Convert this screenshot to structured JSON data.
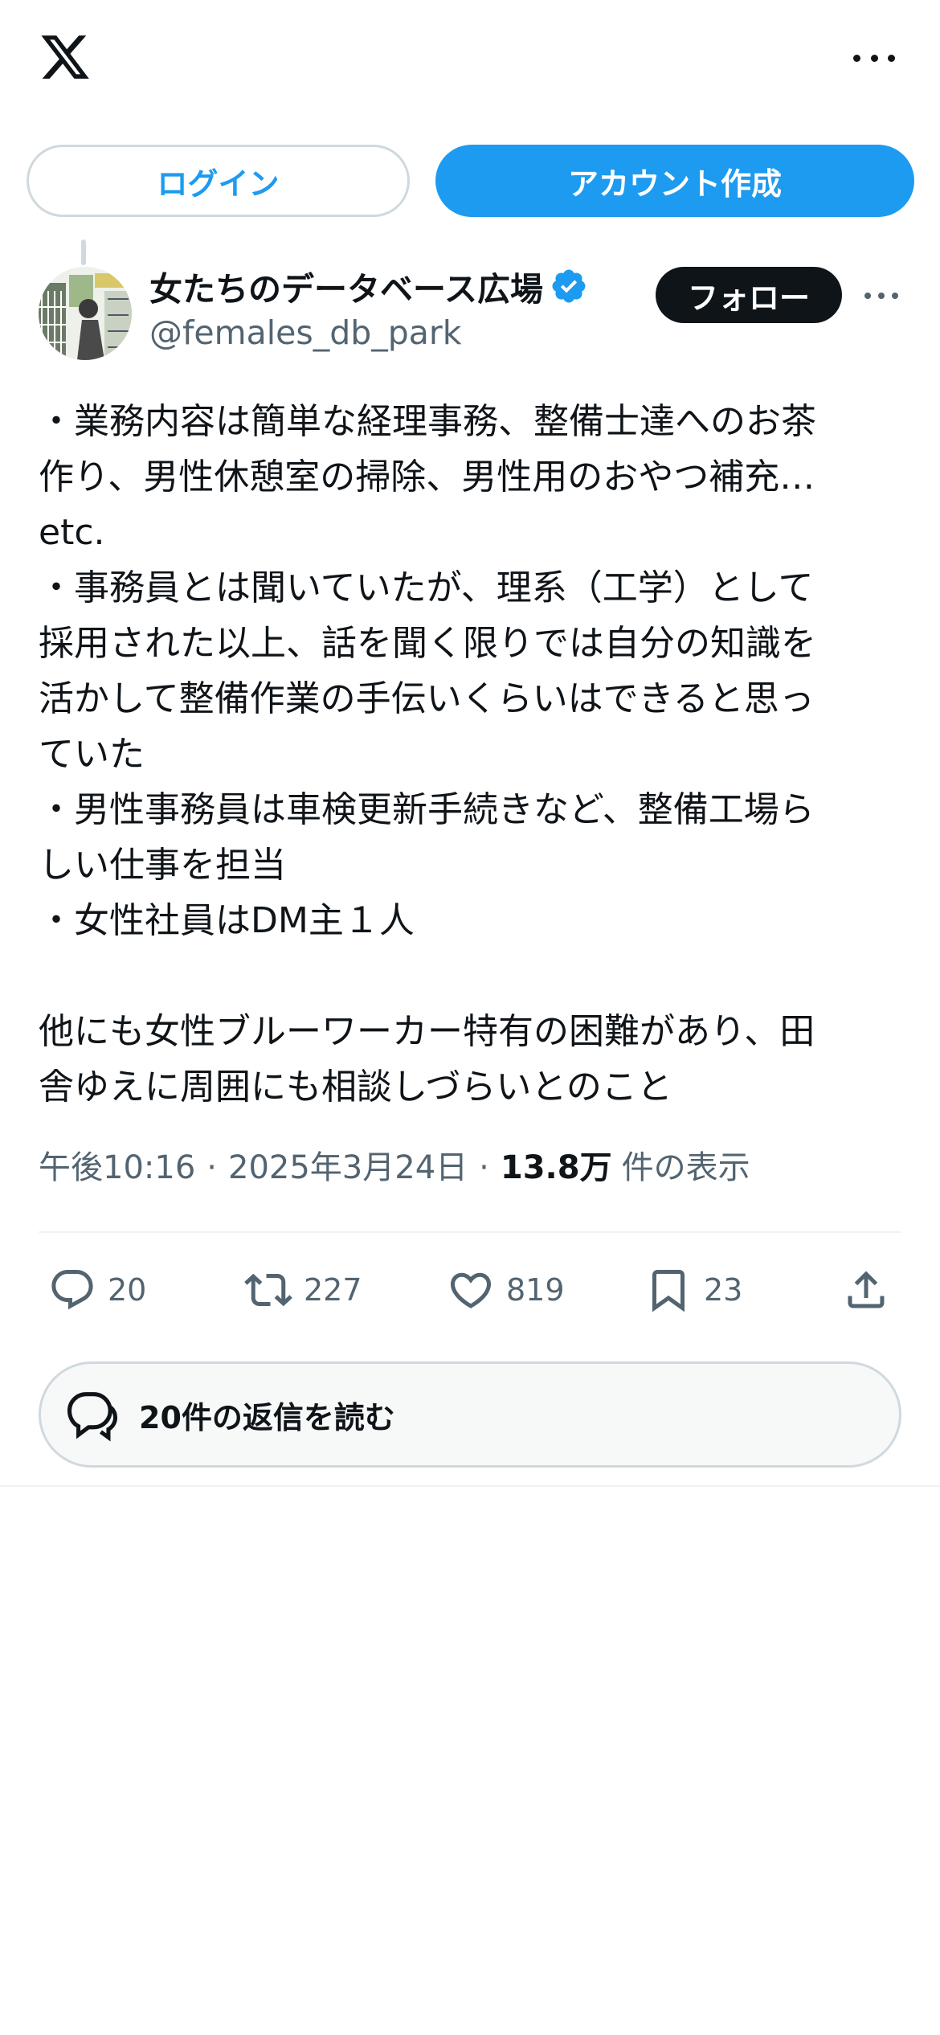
{
  "header": {
    "logo_icon": "x-logo-icon",
    "more_icon": "more-horizontal-icon"
  },
  "auth": {
    "login_label": "ログイン",
    "signup_label": "アカウント作成"
  },
  "author": {
    "display_name": "女たちのデータベース広場",
    "handle": "@females_db_park",
    "verified_icon": "verified-badge-icon",
    "follow_label": "フォロー"
  },
  "post": {
    "lines": [
      "・業務内容は簡単な経理事務、整備士達へのお茶",
      "作り、男性休憩室の掃除、男性用のおやつ補充…",
      "etc.",
      "・事務員とは聞いていたが、理系（工学）として",
      "採用された以上、話を聞く限りでは自分の知識を",
      "活かして整備作業の手伝いくらいはできると思っ",
      "ていた",
      "・男性事務員は車検更新手続きなど、整備工場ら",
      "しい仕事を担当",
      "・女性社員はDM主１人",
      "",
      "他にも女性ブルーワーカー特有の困難があり、田",
      "舎ゆえに周囲にも相談しづらいとのこと"
    ],
    "time": "午後10:16",
    "date": "2025年3月24日",
    "views_count": "13.8万",
    "views_label": "件の表示"
  },
  "actions": {
    "replies": "20",
    "reposts": "227",
    "likes": "819",
    "bookmarks": "23"
  },
  "read_replies": {
    "label": "20件の返信を読む"
  },
  "colors": {
    "accent": "#1d9bf0",
    "text": "#0f1419",
    "secondary": "#536471",
    "border": "#cfd9de"
  }
}
